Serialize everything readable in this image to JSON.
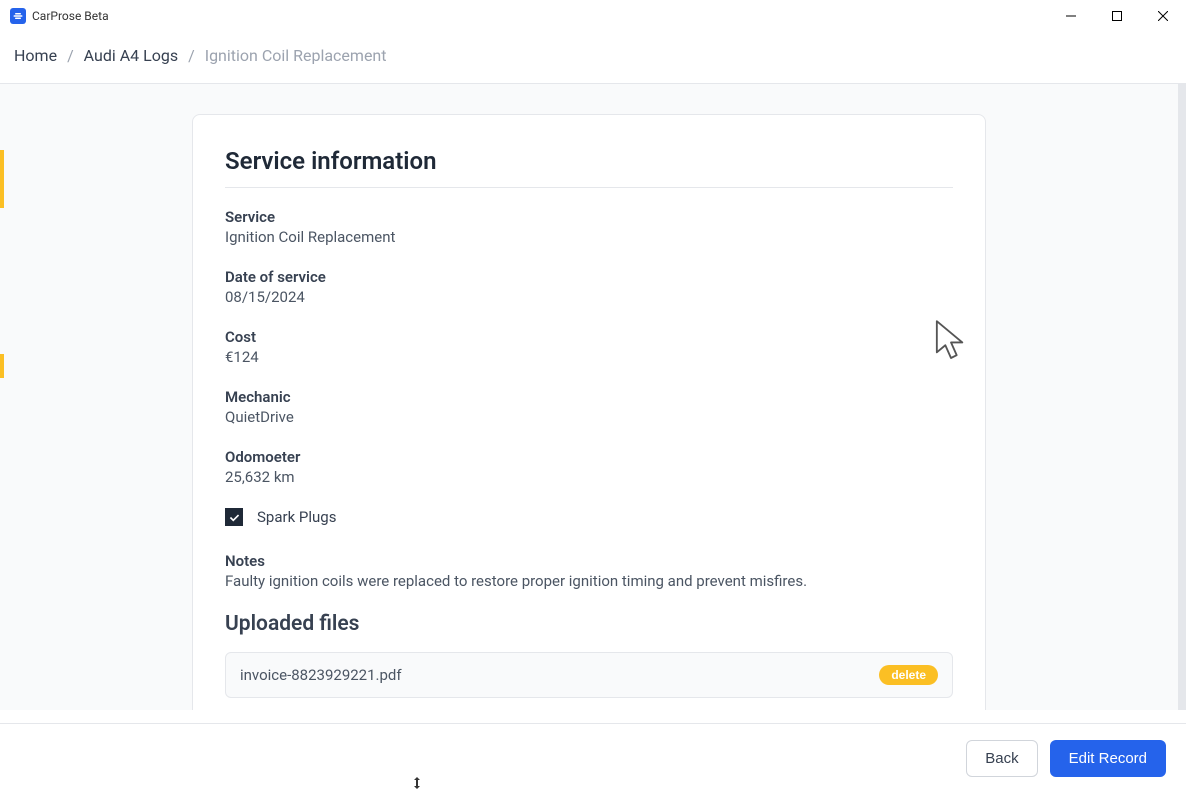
{
  "app": {
    "title": "CarProse Beta"
  },
  "breadcrumb": {
    "home": "Home",
    "parent": "Audi A4 Logs",
    "current": "Ignition Coil Replacement"
  },
  "card": {
    "title": "Service information",
    "fields": {
      "service": {
        "label": "Service",
        "value": "Ignition Coil Replacement"
      },
      "date": {
        "label": "Date of service",
        "value": "08/15/2024"
      },
      "cost": {
        "label": "Cost",
        "value": "€124"
      },
      "mechanic": {
        "label": "Mechanic",
        "value": "QuietDrive"
      },
      "odometer": {
        "label": "Odomoeter",
        "value": "25,632 km"
      }
    },
    "checkbox": {
      "label": "Spark Plugs",
      "checked": true
    },
    "notes": {
      "label": "Notes",
      "value": "Faulty ignition coils were replaced to restore proper ignition timing and prevent misfires."
    },
    "files": {
      "title": "Uploaded files",
      "items": [
        {
          "name": "invoice-8823929221.pdf",
          "delete_label": "delete"
        }
      ]
    }
  },
  "footer": {
    "back": "Back",
    "edit": "Edit Record"
  }
}
